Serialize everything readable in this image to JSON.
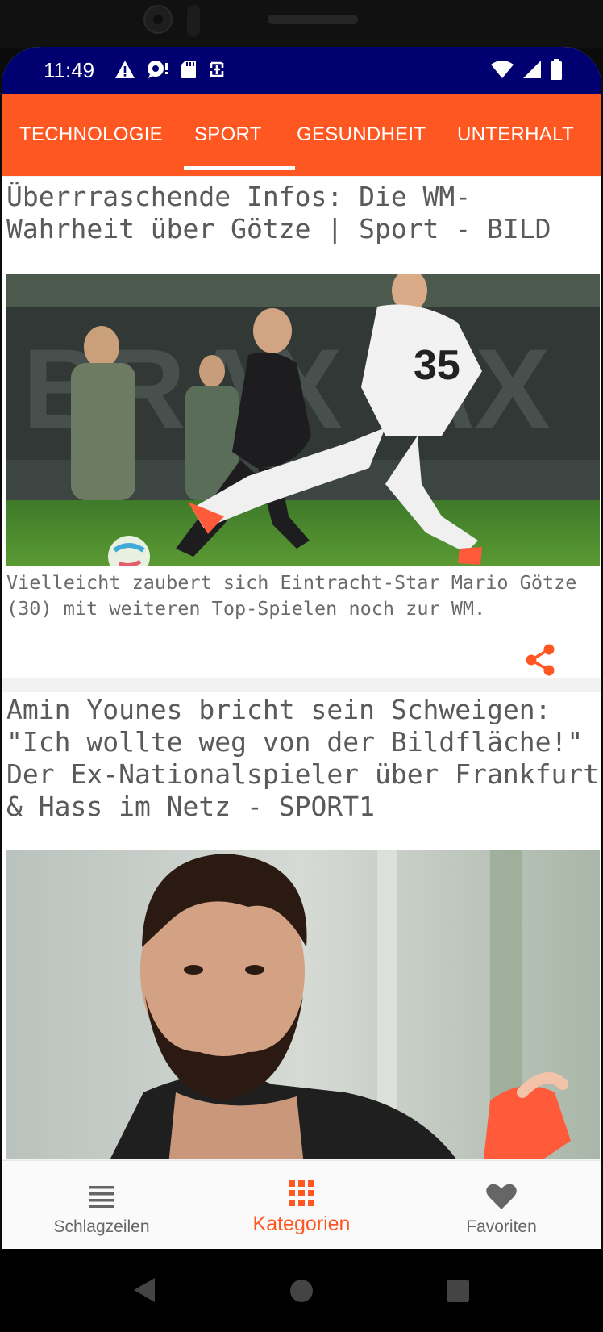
{
  "status_bar": {
    "time": "11:49",
    "left_icons": [
      "warning-icon",
      "location-bubble-icon",
      "sd-card-icon",
      "data-saver-icon"
    ],
    "right_icons": [
      "wifi-icon",
      "cell-signal-icon",
      "battery-icon"
    ]
  },
  "tabs": {
    "items": [
      {
        "label": "TECHNOLOGIE"
      },
      {
        "label": "SPORT"
      },
      {
        "label": "GESUNDHEIT"
      },
      {
        "label": "UNTERHALT"
      }
    ],
    "active_index": 1
  },
  "articles": [
    {
      "title": "Überrraschende Infos: Die WM-Wahrheit über Götze | Sport - BILD",
      "description": "Vielleicht zaubert sich Eintracht-Star Mario Götze (30) mit weiteren Top-Spielen noch zur WM.",
      "share_icon": "share-icon"
    },
    {
      "title": "Amin Younes bricht sein Schweigen: \"Ich wollte weg von der Bildfläche!\" Der Ex-Nationalspieler über Frankfurt & Hass im Netz - SPORT1"
    }
  ],
  "bottom_nav": {
    "items": [
      {
        "label": "Schlagzeilen",
        "icon": "list-icon"
      },
      {
        "label": "Kategorien",
        "icon": "grid-icon"
      },
      {
        "label": "Favoriten",
        "icon": "heart-icon"
      }
    ],
    "active_index": 1
  },
  "colors": {
    "accent": "#ff5722",
    "status_bar": "#000070",
    "inactive": "#666666"
  },
  "system_nav": [
    "back-icon",
    "home-icon",
    "recents-icon"
  ]
}
